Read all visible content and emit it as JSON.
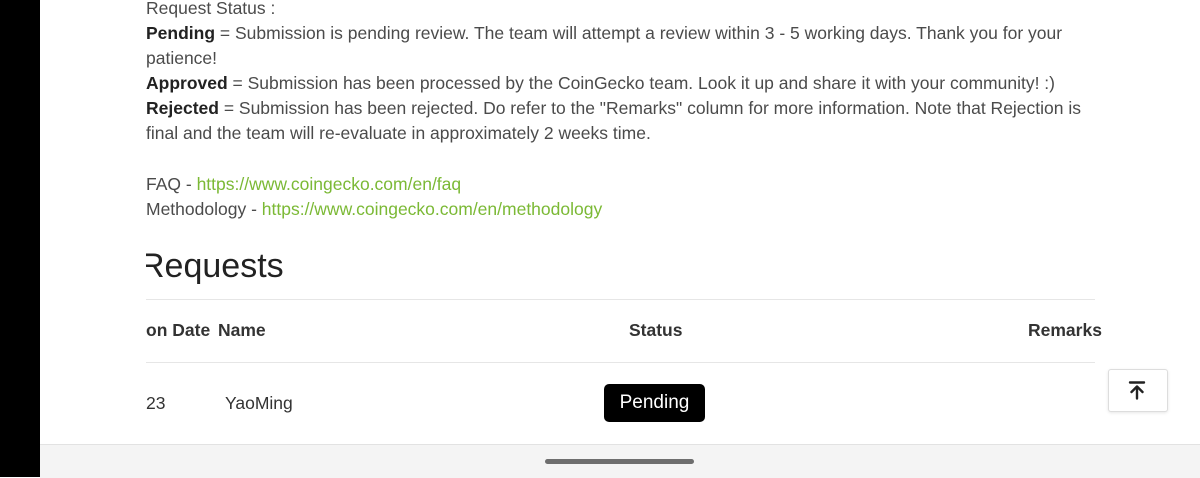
{
  "status_section": {
    "heading": "Request Status :",
    "pending_term": "Pending",
    "pending_desc": " = Submission is pending review. The team will attempt a review within 3 - 5 working days. Thank you for your patience!",
    "approved_term": "Approved",
    "approved_desc": " = Submission has been processed by the CoinGecko team. Look it up and share it with your community! :)",
    "rejected_term": "Rejected",
    "rejected_desc": " = Submission has been rejected. Do refer to the \"Remarks\" column for more information. Note that Rejection is final and the team will re-evaluate in approximately 2 weeks time."
  },
  "links": {
    "faq_label": "FAQ - ",
    "faq_url": "https://www.coingecko.com/en/faq",
    "methodology_label": "Methodology - ",
    "methodology_url": "https://www.coingecko.com/en/methodology"
  },
  "requests": {
    "title": "Requests",
    "columns": {
      "date": "on Date",
      "name": "Name",
      "status": "Status",
      "remarks": "Remarks"
    },
    "rows": [
      {
        "date": "23",
        "name": "YaoMing",
        "status": "Pending",
        "remarks": ""
      }
    ]
  },
  "icons": {
    "scroll_top": "arrow-up-to-line-icon"
  },
  "colors": {
    "link": "#7bb935",
    "badge_bg": "#000000",
    "badge_text": "#ffffff"
  }
}
